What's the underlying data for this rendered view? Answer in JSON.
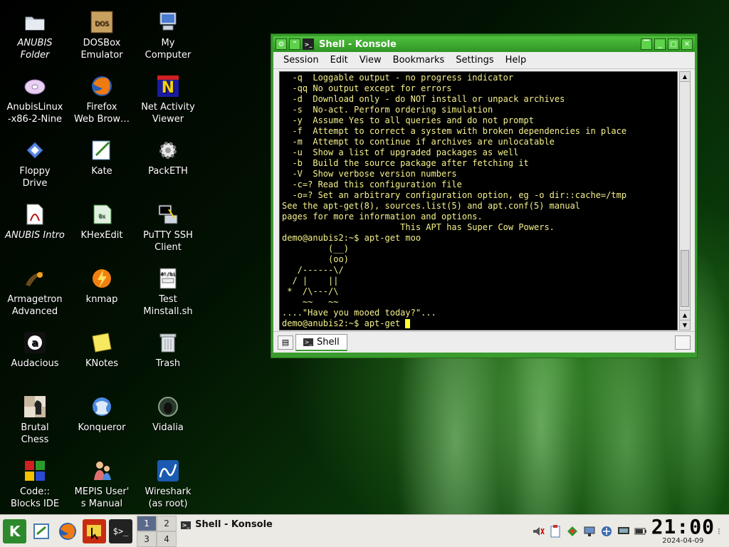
{
  "desktop": {
    "icons": [
      {
        "label": "ANUBIS\nFolder",
        "italic": true,
        "icon": "folder-icon"
      },
      {
        "label": "DOSBox\nEmulator",
        "italic": false,
        "icon": "dosbox-icon"
      },
      {
        "label": "My\nComputer",
        "italic": false,
        "icon": "computer-icon"
      },
      {
        "label": "AnubisLinux\n-x86-2-Nine",
        "italic": false,
        "icon": "disc-icon"
      },
      {
        "label": "Firefox\nWeb Brow…",
        "italic": false,
        "icon": "firefox-icon"
      },
      {
        "label": "Net Activity\nViewer",
        "italic": false,
        "icon": "netactivity-icon"
      },
      {
        "label": "Floppy\nDrive",
        "italic": false,
        "icon": "floppy-icon"
      },
      {
        "label": "Kate",
        "italic": false,
        "icon": "kate-icon"
      },
      {
        "label": "PackETH",
        "italic": false,
        "icon": "gear-icon"
      },
      {
        "label": "ANUBIS Intro",
        "italic": true,
        "icon": "pdf-icon"
      },
      {
        "label": "KHexEdit",
        "italic": false,
        "icon": "hexedit-icon"
      },
      {
        "label": "PuTTY SSH\nClient",
        "italic": false,
        "icon": "putty-icon"
      },
      {
        "label": "Armagetron\nAdvanced",
        "italic": false,
        "icon": "armagetron-icon"
      },
      {
        "label": "knmap",
        "italic": false,
        "icon": "knmap-icon"
      },
      {
        "label": "Test\nMinstall.sh",
        "italic": false,
        "icon": "script-icon"
      },
      {
        "label": "Audacious",
        "italic": false,
        "icon": "audacious-icon"
      },
      {
        "label": "KNotes",
        "italic": false,
        "icon": "notes-icon"
      },
      {
        "label": "Trash",
        "italic": false,
        "icon": "trash-icon"
      },
      {
        "label": "Brutal\nChess",
        "italic": false,
        "icon": "chess-icon"
      },
      {
        "label": "Konqueror",
        "italic": false,
        "icon": "konqueror-icon"
      },
      {
        "label": "Vidalia",
        "italic": false,
        "icon": "vidalia-icon"
      },
      {
        "label": "Code::\nBlocks IDE",
        "italic": false,
        "icon": "codeblocks-icon"
      },
      {
        "label": "MEPIS User'\ns Manual",
        "italic": false,
        "icon": "manual-icon"
      },
      {
        "label": "Wireshark\n(as root)",
        "italic": false,
        "icon": "wireshark-icon"
      }
    ]
  },
  "window": {
    "title": "Shell - Konsole",
    "menu": [
      "Session",
      "Edit",
      "View",
      "Bookmarks",
      "Settings",
      "Help"
    ],
    "terminal_lines": [
      "  -q  Loggable output - no progress indicator",
      "  -qq No output except for errors",
      "  -d  Download only - do NOT install or unpack archives",
      "  -s  No-act. Perform ordering simulation",
      "  -y  Assume Yes to all queries and do not prompt",
      "  -f  Attempt to correct a system with broken dependencies in place",
      "  -m  Attempt to continue if archives are unlocatable",
      "  -u  Show a list of upgraded packages as well",
      "  -b  Build the source package after fetching it",
      "  -V  Show verbose version numbers",
      "  -c=? Read this configuration file",
      "  -o=? Set an arbitrary configuration option, eg -o dir::cache=/tmp",
      "See the apt-get(8), sources.list(5) and apt.conf(5) manual",
      "pages for more information and options.",
      "                       This APT has Super Cow Powers.",
      "demo@anubis2:~$ apt-get moo",
      "         (__)",
      "         (oo)",
      "   /------\\/",
      "  / |    ||",
      " *  /\\---/\\",
      "    ~~   ~~",
      "....\"Have you mooed today?\"...",
      "demo@anubis2:~$ apt-get "
    ],
    "tab_label": "Shell"
  },
  "taskbar": {
    "pager": [
      "1",
      "2",
      "3",
      "4"
    ],
    "active_desktop": "1",
    "task_title": "Shell - Konsole",
    "clock_time": "21:00",
    "clock_date": "2024-04-09"
  },
  "colors": {
    "window_frame": "#3a9b2e",
    "terminal_text": "#f6f18b",
    "terminal_bg": "#000000",
    "cursor": "#ffff33"
  }
}
